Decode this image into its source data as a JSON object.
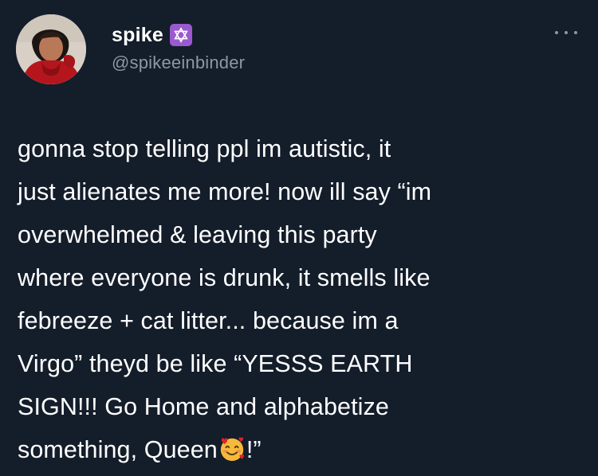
{
  "author": {
    "display_name": "spike",
    "handle": "@spikeeinbinder",
    "badge_icon": "star-of-david-icon",
    "avatar_icon": "profile-photo"
  },
  "menu": {
    "icon": "more-options-icon"
  },
  "tweet": {
    "lines": [
      "gonna stop telling ppl im autistic, it",
      "just alienates me more! now ill say “im",
      "overwhelmed & leaving this party",
      "where everyone is drunk, it smells like",
      "febreeze + cat litter... because im a",
      "Virgo” theyd be like “YESSS EARTH",
      "SIGN!!! Go Home and alphabetize"
    ],
    "last_line_before_emoji": "something, Queen",
    "last_line_after_emoji": "!”",
    "emoji_icon": "smiling-face-with-hearts-icon"
  },
  "colors": {
    "background": "#141d2a",
    "text": "#ffffff",
    "secondary_text": "#8b98a5",
    "badge": "#9b59d0"
  }
}
